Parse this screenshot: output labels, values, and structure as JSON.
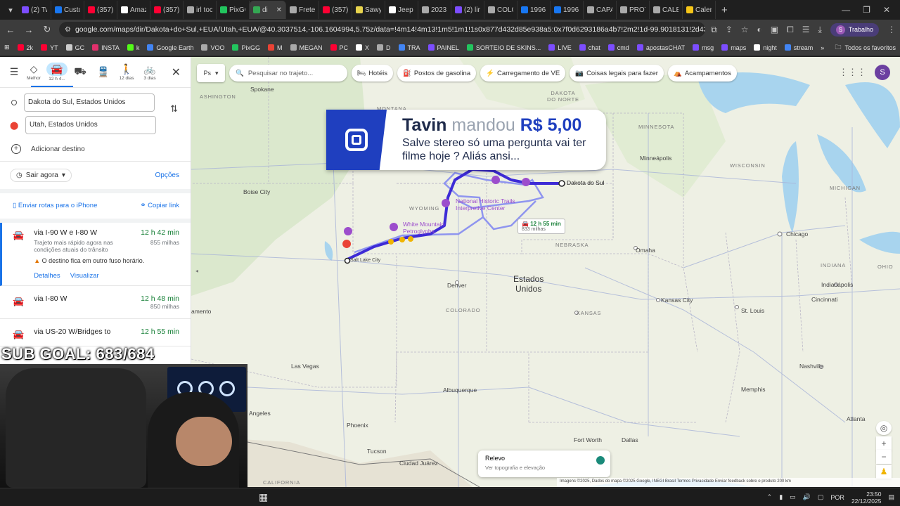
{
  "browser": {
    "tabs": [
      {
        "label": "(2) Tw",
        "color": "#7c4dff"
      },
      {
        "label": "Custo",
        "color": "#1877f2"
      },
      {
        "label": "(357)",
        "color": "#ff0033"
      },
      {
        "label": "Amaz",
        "color": "#ffffff"
      },
      {
        "label": "(357)",
        "color": "#ff0033"
      },
      {
        "label": "irl toc",
        "color": "#aaaaaa"
      },
      {
        "label": "PixGG",
        "color": "#22c55e"
      },
      {
        "label": "di",
        "color": "#34a853"
      },
      {
        "label": "Frete",
        "color": "#aaaaaa"
      },
      {
        "label": "(357)",
        "color": "#ff0033"
      },
      {
        "label": "Sawy",
        "color": "#e8d44d"
      },
      {
        "label": "Jeep",
        "color": "#ffffff"
      },
      {
        "label": "2023",
        "color": "#aaaaaa"
      },
      {
        "label": "(2) lin",
        "color": "#7c4dff"
      },
      {
        "label": "COLO",
        "color": "#aaaaaa"
      },
      {
        "label": "1996",
        "color": "#1877f2"
      },
      {
        "label": "1996",
        "color": "#1877f2"
      },
      {
        "label": "CAPA",
        "color": "#aaaaaa"
      },
      {
        "label": "PROT",
        "color": "#aaaaaa"
      },
      {
        "label": "CALE",
        "color": "#aaaaaa"
      },
      {
        "label": "Calen",
        "color": "#f5c518"
      }
    ],
    "new_tab": "+",
    "url": "google.com/maps/dir/Dakota+do+Sul,+EUA/Utah,+EUA/@40.3037514,-106.1604994,5.75z/data=!4m14!4m13!1m5!1m1!1s0x877d432d85e938a5:0x7f0d6293186a4b7!2m2!1d-99.9018131!2d43.9695148!1m5!1m1!1s0x874...",
    "profile_label": "Trabalho",
    "profile_initial": "S",
    "bookmarks": [
      {
        "label": "2k",
        "color": "#ff0033"
      },
      {
        "label": "YT",
        "color": "#ff0033"
      },
      {
        "label": "GC",
        "color": "#cccccc"
      },
      {
        "label": "INSTA",
        "color": "#e1306c"
      },
      {
        "label": "k",
        "color": "#53fc18"
      },
      {
        "label": "Google Earth",
        "color": "#4285f4"
      },
      {
        "label": "VOO",
        "color": "#aaaaaa"
      },
      {
        "label": "PixGG",
        "color": "#22c55e"
      },
      {
        "label": "M",
        "color": "#ea4335"
      },
      {
        "label": "MEGAN",
        "color": "#aaaaaa"
      },
      {
        "label": "PC",
        "color": "#ff0033"
      },
      {
        "label": "X",
        "color": "#ffffff"
      },
      {
        "label": "D",
        "color": "#aaaaaa"
      },
      {
        "label": "TRA",
        "color": "#4285f4"
      },
      {
        "label": "PAINEL",
        "color": "#7c4dff"
      },
      {
        "label": "SORTEIO DE SKINS...",
        "color": "#22c55e"
      },
      {
        "label": "LIVE",
        "color": "#7c4dff"
      },
      {
        "label": "chat",
        "color": "#7c4dff"
      },
      {
        "label": "cmd",
        "color": "#7c4dff"
      },
      {
        "label": "apostasCHAT",
        "color": "#7c4dff"
      },
      {
        "label": "msg",
        "color": "#7c4dff"
      },
      {
        "label": "maps",
        "color": "#7c4dff"
      },
      {
        "label": "night",
        "color": "#ffffff"
      },
      {
        "label": "stream",
        "color": "#4285f4"
      }
    ],
    "bookmarks_folder": "Todos os favoritos"
  },
  "directions": {
    "modes": [
      {
        "icon": "best-icon",
        "glyph": "◇",
        "label": "Melhor",
        "selected": false
      },
      {
        "icon": "car-icon",
        "glyph": "🚘",
        "label": "12 h 4...",
        "selected": true
      },
      {
        "icon": "motorcycle-icon",
        "glyph": "⛟",
        "label": "",
        "selected": false
      },
      {
        "icon": "transit-icon",
        "glyph": "🚆",
        "label": "",
        "selected": false
      },
      {
        "icon": "walk-icon",
        "glyph": "🚶",
        "label": "12 dias",
        "selected": false
      },
      {
        "icon": "bicycle-icon",
        "glyph": "🚲",
        "label": "3 dias",
        "selected": false
      }
    ],
    "origin": "Dakota do Sul, Estados Unidos",
    "destination": "Utah, Estados Unidos",
    "add_destination": "Adicionar destino",
    "depart": "Sair agora",
    "options": "Opções",
    "send_to_phone": "Enviar rotas para o iPhone",
    "copy_link": "Copiar link",
    "routes": [
      {
        "title": "via I-90 W e I-80 W",
        "time": "12 h 42 min",
        "desc": "Trajeto mais rápido agora nas condições atuais do trânsito",
        "distance": "855 milhas",
        "warning": "O destino fica em outro fuso horário.",
        "details": "Detalhes",
        "preview": "Visualizar"
      },
      {
        "title": "via I-80 W",
        "time": "12 h 48 min",
        "distance": "850 milhas"
      },
      {
        "title": "via US-20 W/Bridges to",
        "time": "12 h 55 min"
      }
    ]
  },
  "map": {
    "layer_toggle": "Ps",
    "search_placeholder": "Pesquisar no trajeto...",
    "chips": [
      {
        "icon": "hotel-icon",
        "glyph": "🛏",
        "label": "Hotéis"
      },
      {
        "icon": "gas-station-icon",
        "glyph": "⛽",
        "label": "Postos de gasolina"
      },
      {
        "icon": "ev-charging-icon",
        "glyph": "⚡",
        "label": "Carregamento de VE"
      },
      {
        "icon": "camera-icon",
        "glyph": "📷",
        "label": "Coisas legais para fazer"
      },
      {
        "icon": "camping-icon",
        "glyph": "⛺",
        "label": "Acampamentos"
      }
    ],
    "avatar": "S",
    "labels": {
      "washington": "ASHINGTON",
      "spokane": "Spokane",
      "montana": "MONTANA",
      "north_dakota": "DAKOTA\nDO NORTE",
      "minnesota": "MINNESOTA",
      "wisconsin": "WISCONSIN",
      "michigan": "MICHIGAN",
      "minneapolis": "Minneápolis",
      "boise": "Boise City",
      "wyoming": "WYOMING",
      "nebraska": "NEBRASKA",
      "omaha": "Omaha",
      "chicago": "Chicago",
      "indiana": "INDIANA",
      "indianapolis": "Indianápolis",
      "ohio": "OHIO",
      "salt_lake": "Salt Lake City",
      "denver": "Denver",
      "colorado": "COLORADO",
      "kansas": "KANSAS",
      "kansas_city": "Kansas City",
      "st_louis": "St. Louis",
      "cincinnati": "Cincinnati",
      "usa": "Estados\nUnidos",
      "las_vegas": "Las Vegas",
      "nevada": "amento",
      "nashville": "Nashville",
      "albuquerque": "Albuquerque",
      "memphis": "Memphis",
      "angeles": "Angeles",
      "phoenix": "Phoenix",
      "tucson": "Tucson",
      "fort_worth": "Fort Worth",
      "dallas": "Dallas",
      "atlanta": "Atlanta",
      "juarez": "Ciudad Juárez",
      "california": "CALIFORNIA",
      "dakota_sul": "Dakota do Sul",
      "national_trails": "National Historic Trails\nInterpretive Center",
      "white_mountain": "White Mountain\nPetroglyphs"
    },
    "route_box": {
      "time": "12 h 55 min",
      "distance": "833 milhas"
    },
    "layer": {
      "title": "Relevo",
      "subtitle": "Ver topografia e elevação"
    },
    "attribution": "Imagens ©2025, Dados do mapa ©2025 Google, INEGI   Brasil   Termos   Privacidade   Enviar feedback sobre o produto   200 km"
  },
  "alert": {
    "name": "Tavin",
    "verb": "mandou",
    "amount": "R$ 5,00",
    "message": "Salve stereo só uma pergunta vai ter filme hoje ? Aliás ansi..."
  },
  "stream": {
    "sub_goal": "SUB GOAL: 683/684"
  },
  "taskbar": {
    "lang": "POR",
    "time": "23:50",
    "date": "22/12/2025"
  },
  "colors": {
    "route_primary": "#3d2bd6",
    "route_alt": "#9aa3f5",
    "poi": "#9c4dcc",
    "google_blue": "#1a73e8",
    "green_time": "#188038"
  }
}
